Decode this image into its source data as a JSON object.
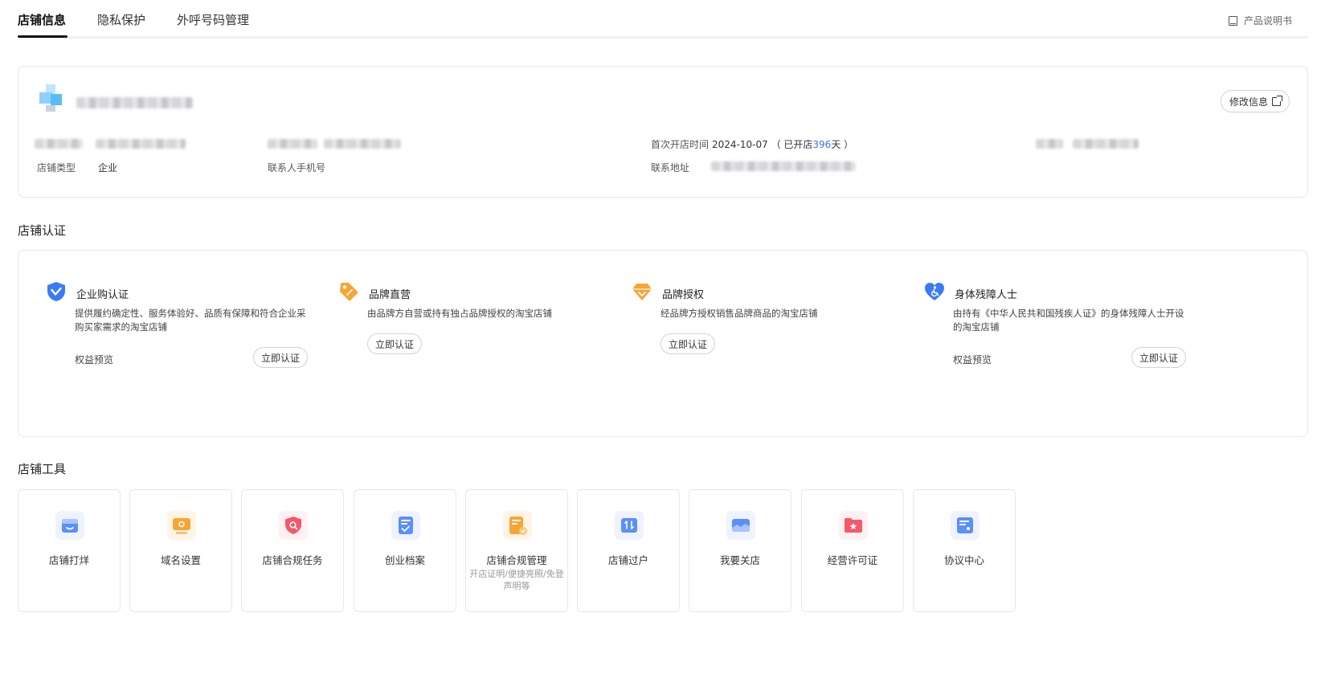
{
  "tabs": [
    {
      "label": "店铺信息",
      "active": true
    },
    {
      "label": "隐私保护",
      "active": false
    },
    {
      "label": "外呼号码管理",
      "active": false
    }
  ],
  "header": {
    "manual_label": "产品说明书"
  },
  "shop": {
    "edit_label": "修改信息",
    "shop_type_label": "店铺类型",
    "shop_type_value": "企业",
    "contact_phone_label": "联系人手机号",
    "first_open_label": "首次开店时间",
    "first_open_date": "2024-10-07",
    "open_prefix": "（ 已开店",
    "open_days": "396",
    "open_suffix": "天 ）",
    "address_label": "联系地址"
  },
  "cert": {
    "section_title": "店铺认证",
    "items": [
      {
        "title": "企业购认证",
        "desc": "提供履约确定性、服务体验好、品质有保障和符合企业采购买家需求的淘宝店铺",
        "benefit": "权益预览",
        "button": "立即认证",
        "icon": "shield-check-icon",
        "color": "#3a7bf5"
      },
      {
        "title": "品牌直营",
        "desc": "由品牌方自营或持有独占品牌授权的淘宝店铺",
        "benefit": "",
        "button": "立即认证",
        "icon": "tag-icon",
        "color": "#f7a534"
      },
      {
        "title": "品牌授权",
        "desc": "经品牌方授权销售品牌商品的淘宝店铺",
        "benefit": "",
        "button": "立即认证",
        "icon": "diamond-icon",
        "color": "#f7a534"
      },
      {
        "title": "身体残障人士",
        "desc": "由持有《中华人民共和国残疾人证》的身体残障人士开设的淘宝店铺",
        "benefit": "权益预览",
        "button": "立即认证",
        "icon": "heart-accessibility-icon",
        "color": "#3a7bf5"
      }
    ]
  },
  "tools": {
    "section_title": "店铺工具",
    "items": [
      {
        "label": "店铺打烊",
        "sub": "",
        "icon": "store-close-icon",
        "color": "#5b8ff9"
      },
      {
        "label": "域名设置",
        "sub": "",
        "icon": "domain-settings-icon",
        "color": "#f7a534"
      },
      {
        "label": "店铺合规任务",
        "sub": "",
        "icon": "compliance-shield-icon",
        "color": "#f25a6a"
      },
      {
        "label": "创业档案",
        "sub": "",
        "icon": "archive-icon",
        "color": "#5b8ff9"
      },
      {
        "label": "店铺合规管理",
        "sub": "开店证明/便捷亮照/免登声明等",
        "icon": "compliance-doc-icon",
        "color": "#f7a534"
      },
      {
        "label": "店铺过户",
        "sub": "",
        "icon": "transfer-icon",
        "color": "#5b8ff9"
      },
      {
        "label": "我要关店",
        "sub": "",
        "icon": "close-shop-icon",
        "color": "#5b8ff9"
      },
      {
        "label": "经营许可证",
        "sub": "",
        "icon": "license-icon",
        "color": "#f25a6a"
      },
      {
        "label": "协议中心",
        "sub": "",
        "icon": "agreement-icon",
        "color": "#5b8ff9"
      }
    ]
  }
}
